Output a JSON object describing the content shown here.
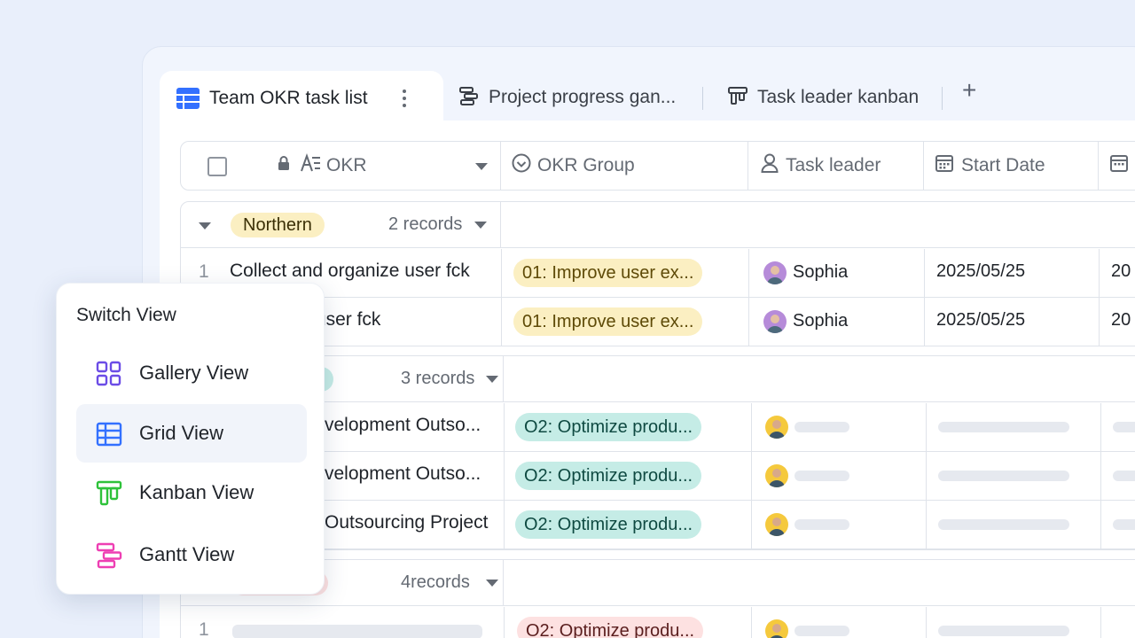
{
  "tabs": [
    {
      "label": "Team OKR task list",
      "active": true,
      "icon": "grid-view-icon"
    },
    {
      "label": "Project progress gan...",
      "icon": "gantt-icon"
    },
    {
      "label": "Task leader kanban",
      "icon": "kanban-icon"
    }
  ],
  "tab_add": "+",
  "columns": {
    "okr": "OKR",
    "okr_group": "OKR Group",
    "task_leader": "Task leader",
    "start_date": "Start Date"
  },
  "groups": [
    {
      "name": "Northern",
      "records": "2 records",
      "color": "#fbefc2",
      "rows": [
        {
          "num": "1",
          "okr": "Collect and organize user fck",
          "group": "01: Improve user ex...",
          "leader": "Sophia",
          "start": "2025/05/25",
          "next": "20"
        },
        {
          "num": "",
          "okr": "l organize user fck",
          "group": "01: Improve user ex...",
          "leader": "Sophia",
          "start": "2025/05/25",
          "next": "20"
        }
      ]
    },
    {
      "name": "",
      "records": "3 records",
      "color": "#c5ece6",
      "rows": [
        {
          "okr": "velopment Outso...",
          "group": "O2: Optimize produ..."
        },
        {
          "okr": "velopment Outso...",
          "group": "O2: Optimize produ..."
        },
        {
          "okr": "Outsourcing Project",
          "group": "O2: Optimize produ..."
        }
      ]
    },
    {
      "name": "",
      "records": "4records",
      "color": "#fde1e1",
      "rows": [
        {
          "num": "1",
          "group": "O2: Optimize produ..."
        }
      ]
    }
  ],
  "switch_view": {
    "title": "Switch View",
    "items": [
      {
        "label": "Gallery View",
        "icon": "gallery-icon",
        "color": "#6b4ce6"
      },
      {
        "label": "Grid View",
        "icon": "grid-view-icon",
        "color": "#3370ff",
        "active": true
      },
      {
        "label": "Kanban View",
        "icon": "kanban-icon",
        "color": "#2ec23a"
      },
      {
        "label": "Gantt View",
        "icon": "gantt-icon",
        "color": "#ee3fb3"
      }
    ]
  }
}
